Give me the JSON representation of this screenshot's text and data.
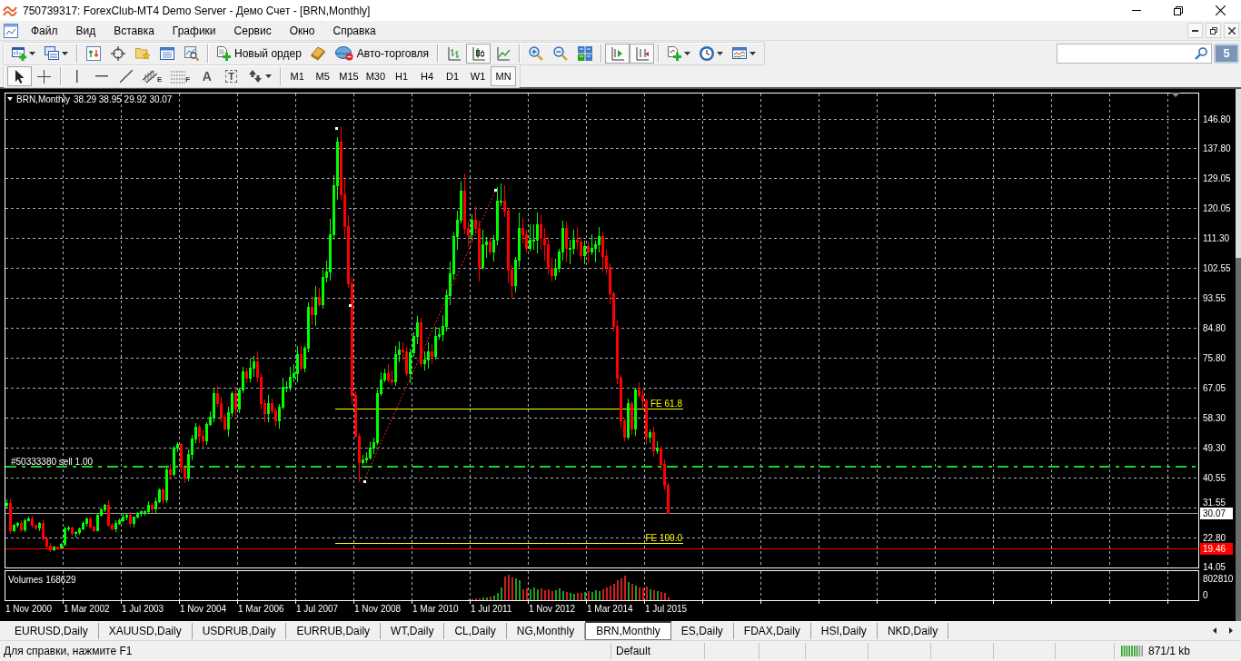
{
  "window": {
    "title": "750739317: ForexClub-MT4 Demo Server - Демо Счет - [BRN,Monthly]"
  },
  "menu": [
    "Файл",
    "Вид",
    "Вставка",
    "Графики",
    "Сервис",
    "Окно",
    "Справка"
  ],
  "main_toolbar": {
    "new_order": "Новый ордер",
    "auto_trading": "Авто-торговля",
    "chart_types": [
      {
        "selected": false
      },
      {
        "selected": true
      },
      {
        "selected": false
      }
    ],
    "auto_scroll": true,
    "chart_shift": true
  },
  "community_badge": "5",
  "drawing_toolbar": {
    "pointer_tools": [
      {
        "selected": true
      },
      {
        "selected": false
      }
    ],
    "channel_mark": "E",
    "fibo_mark": "F",
    "text_tool": "A",
    "label_tool": "T",
    "periods": [
      {
        "label": "M1",
        "selected": false
      },
      {
        "label": "M5",
        "selected": false
      },
      {
        "label": "M15",
        "selected": false
      },
      {
        "label": "M30",
        "selected": false
      },
      {
        "label": "H1",
        "selected": false
      },
      {
        "label": "H4",
        "selected": false
      },
      {
        "label": "D1",
        "selected": false
      },
      {
        "label": "W1",
        "selected": false
      },
      {
        "label": "MN",
        "selected": true
      }
    ]
  },
  "chart": {
    "symbol": "BRN,Monthly",
    "ohlc": "38.29 38.95 29.92 30.07",
    "order_label": "#50333380 sell 1.00",
    "fibo_levels": [
      "FE 61.8",
      "FE 100.0"
    ],
    "bid_tag": "30.07",
    "level_tag": "19.46",
    "price_scale": [
      "146.80",
      "137.80",
      "129.05",
      "120.05",
      "111.30",
      "102.55",
      "93.55",
      "84.80",
      "75.80",
      "67.05",
      "58.30",
      "49.30",
      "40.55",
      "31.55",
      "22.80",
      "14.05"
    ],
    "volume_label": "Volumes 168629",
    "volume_scale": [
      "802810",
      "0"
    ],
    "time_scale": [
      "1 Nov 2000",
      "1 Mar 2002",
      "1 Jul 2003",
      "1 Nov 2004",
      "1 Mar 2006",
      "1 Jul 2007",
      "1 Nov 2008",
      "1 Mar 2010",
      "1 Jul 2011",
      "1 Nov 2012",
      "1 Mar 2014",
      "1 Jul 2015"
    ]
  },
  "tabs": [
    {
      "label": "EURUSD,Daily",
      "selected": false
    },
    {
      "label": "XAUUSD,Daily",
      "selected": false
    },
    {
      "label": "USDRUB,Daily",
      "selected": false
    },
    {
      "label": "EURRUB,Daily",
      "selected": false
    },
    {
      "label": "WT,Daily",
      "selected": false
    },
    {
      "label": "CL,Daily",
      "selected": false
    },
    {
      "label": "NG,Monthly",
      "selected": false
    },
    {
      "label": "BRN,Monthly",
      "selected": true
    },
    {
      "label": "ES,Daily",
      "selected": false
    },
    {
      "label": "FDAX,Daily",
      "selected": false
    },
    {
      "label": "HSI,Daily",
      "selected": false
    },
    {
      "label": "NKD,Daily",
      "selected": false
    }
  ],
  "status_bar": {
    "help": "Для справки, нажмите F1",
    "profile": "Default",
    "traffic": "871/1 kb"
  }
}
